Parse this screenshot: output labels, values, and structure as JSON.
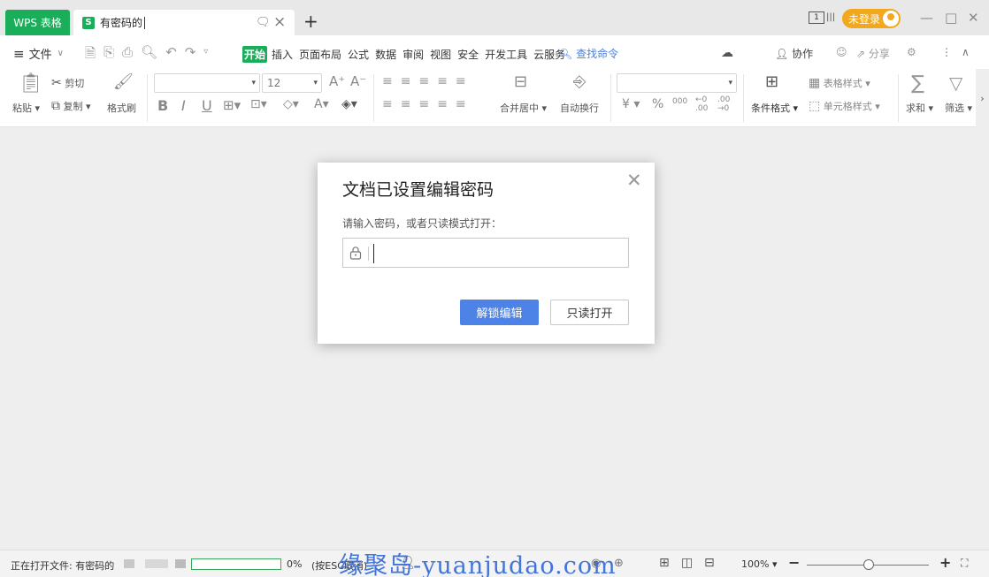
{
  "titlebar": {
    "app_tab": "WPS 表格",
    "doc_tab": {
      "badge": "S",
      "name": "有密码的"
    },
    "new_tab": "+",
    "page_indicator": "1",
    "login_label": "未登录",
    "minimize": "—",
    "maximize": "□",
    "close": "✕"
  },
  "menubar": {
    "file_label": "文件",
    "items": [
      "开始",
      "插入",
      "页面布局",
      "公式",
      "数据",
      "审阅",
      "视图",
      "安全",
      "开发工具",
      "云服务"
    ],
    "active_item": "开始",
    "search_cmd": "查找命令",
    "collab": "协作",
    "share": "分享"
  },
  "ribbon": {
    "paste": "粘贴",
    "cut": "剪切",
    "copy": "复制",
    "format_painter": "格式刷",
    "font_size": "12",
    "merge_center": "合并居中",
    "auto_wrap": "自动换行",
    "currency": "¥",
    "percent": "%",
    "conditional_format": "条件格式",
    "table_style": "表格样式",
    "cell_style": "单元格样式",
    "sum": "求和",
    "filter": "筛选"
  },
  "dialog": {
    "title": "文档已设置编辑密码",
    "prompt": "请输入密码，或者只读模式打开：",
    "password_value": "",
    "unlock_button": "解锁编辑",
    "readonly_button": "只读打开"
  },
  "statusbar": {
    "opening_text": "正在打开文件: 有密码的",
    "progress_percent": 0,
    "progress_label": "0%",
    "esc_hint": "(按ESC取消)",
    "zoom": "100%",
    "zoom_minus": "−",
    "zoom_plus": "+"
  },
  "watermark": "缘聚岛-yuanjudao.com",
  "colors": {
    "brand_green": "#1aae5a",
    "primary_blue": "#4d82e6",
    "login_orange": "#f2a81d"
  }
}
